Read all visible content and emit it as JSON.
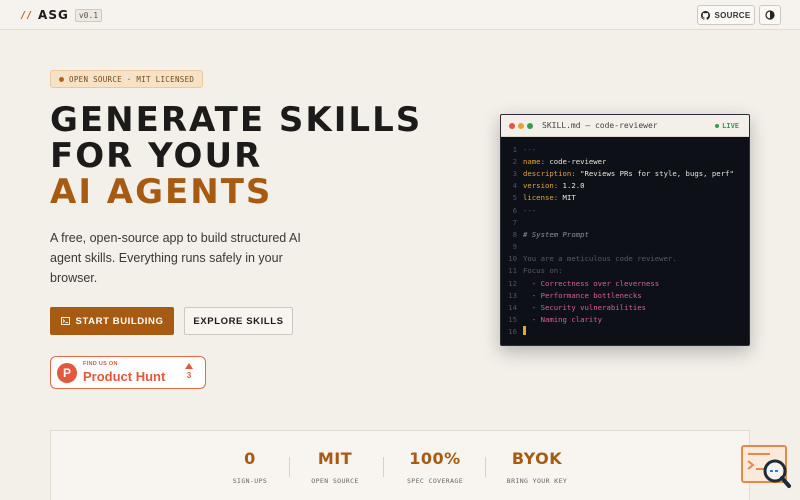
{
  "header": {
    "logo_slashes": "//",
    "logo_name": "ASG",
    "version": "v0.1",
    "source_label": "SOURCE"
  },
  "hero": {
    "badge": "OPEN SOURCE · MIT LICENSED",
    "title_line1": "GENERATE SKILLS",
    "title_line2": "FOR YOUR",
    "title_line3": "AI AGENTS",
    "subtitle": "A free, open-source app to build structured AI agent skills. Everything runs safely in your browser.",
    "primary_button": "START BUILDING",
    "secondary_button": "EXPLORE SKILLS"
  },
  "product_hunt": {
    "small_text": "FIND US ON",
    "big_text": "Product Hunt",
    "votes": "3"
  },
  "editor": {
    "title": "SKILL.md — code-reviewer",
    "status": "LIVE",
    "lines": [
      {
        "n": "1",
        "text": "---"
      },
      {
        "n": "2",
        "key": "name:",
        "val": " code-reviewer"
      },
      {
        "n": "3",
        "key": "description:",
        "val": " \"Reviews PRs for style, bugs, perf\""
      },
      {
        "n": "4",
        "key": "version:",
        "val": " 1.2.0"
      },
      {
        "n": "5",
        "key": "license:",
        "val": " MIT"
      },
      {
        "n": "6",
        "text": "---"
      },
      {
        "n": "7",
        "text": ""
      },
      {
        "n": "8",
        "comment": "# System Prompt"
      },
      {
        "n": "9",
        "text": ""
      },
      {
        "n": "10",
        "dim": "You are a meticulous code reviewer."
      },
      {
        "n": "11",
        "dim": "Focus on:"
      },
      {
        "n": "12",
        "bullet": "  - Correctness over cleverness"
      },
      {
        "n": "13",
        "bullet": "  - Performance bottlenecks"
      },
      {
        "n": "14",
        "bullet": "  - Security vulnerabilities"
      },
      {
        "n": "15",
        "bullet": "  - Naming clarity"
      },
      {
        "n": "16",
        "cursor": true
      }
    ]
  },
  "stats": [
    {
      "value": "0",
      "label": "SIGN-UPS"
    },
    {
      "value": "MIT",
      "label": "OPEN SOURCE"
    },
    {
      "value": "100%",
      "label": "SPEC COVERAGE"
    },
    {
      "value": "BYOK",
      "label": "BRING YOUR KEY"
    }
  ],
  "colors": {
    "accent": "#a65a12",
    "background": "#f3efe9",
    "editor_bg": "#0d1017",
    "product_hunt": "#e4583b",
    "live": "#3a9a4f"
  },
  "icons": {
    "source": "github-icon",
    "theme": "theme-toggle-icon",
    "start": "terminal-icon",
    "widget": "search-code-icon"
  }
}
